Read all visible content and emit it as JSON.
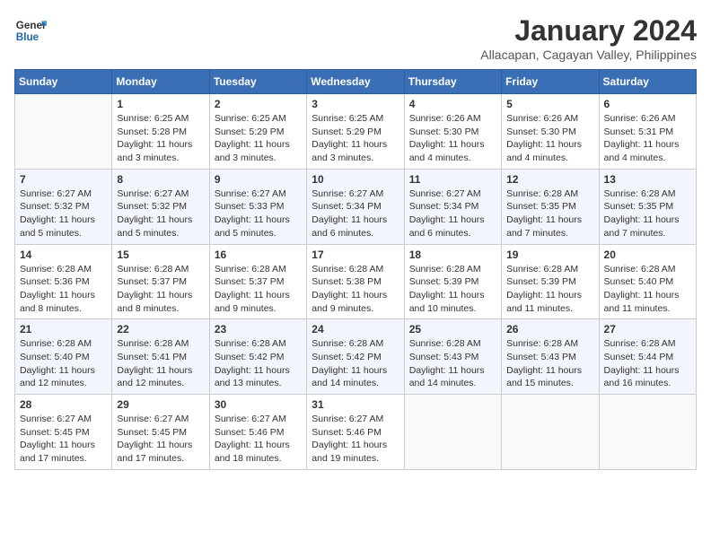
{
  "header": {
    "logo_general": "General",
    "logo_blue": "Blue",
    "month_title": "January 2024",
    "subtitle": "Allacapan, Cagayan Valley, Philippines"
  },
  "columns": [
    "Sunday",
    "Monday",
    "Tuesday",
    "Wednesday",
    "Thursday",
    "Friday",
    "Saturday"
  ],
  "weeks": [
    [
      {
        "day": "",
        "info": ""
      },
      {
        "day": "1",
        "info": "Sunrise: 6:25 AM\nSunset: 5:28 PM\nDaylight: 11 hours\nand 3 minutes."
      },
      {
        "day": "2",
        "info": "Sunrise: 6:25 AM\nSunset: 5:29 PM\nDaylight: 11 hours\nand 3 minutes."
      },
      {
        "day": "3",
        "info": "Sunrise: 6:25 AM\nSunset: 5:29 PM\nDaylight: 11 hours\nand 3 minutes."
      },
      {
        "day": "4",
        "info": "Sunrise: 6:26 AM\nSunset: 5:30 PM\nDaylight: 11 hours\nand 4 minutes."
      },
      {
        "day": "5",
        "info": "Sunrise: 6:26 AM\nSunset: 5:30 PM\nDaylight: 11 hours\nand 4 minutes."
      },
      {
        "day": "6",
        "info": "Sunrise: 6:26 AM\nSunset: 5:31 PM\nDaylight: 11 hours\nand 4 minutes."
      }
    ],
    [
      {
        "day": "7",
        "info": "Sunrise: 6:27 AM\nSunset: 5:32 PM\nDaylight: 11 hours\nand 5 minutes."
      },
      {
        "day": "8",
        "info": "Sunrise: 6:27 AM\nSunset: 5:32 PM\nDaylight: 11 hours\nand 5 minutes."
      },
      {
        "day": "9",
        "info": "Sunrise: 6:27 AM\nSunset: 5:33 PM\nDaylight: 11 hours\nand 5 minutes."
      },
      {
        "day": "10",
        "info": "Sunrise: 6:27 AM\nSunset: 5:34 PM\nDaylight: 11 hours\nand 6 minutes."
      },
      {
        "day": "11",
        "info": "Sunrise: 6:27 AM\nSunset: 5:34 PM\nDaylight: 11 hours\nand 6 minutes."
      },
      {
        "day": "12",
        "info": "Sunrise: 6:28 AM\nSunset: 5:35 PM\nDaylight: 11 hours\nand 7 minutes."
      },
      {
        "day": "13",
        "info": "Sunrise: 6:28 AM\nSunset: 5:35 PM\nDaylight: 11 hours\nand 7 minutes."
      }
    ],
    [
      {
        "day": "14",
        "info": "Sunrise: 6:28 AM\nSunset: 5:36 PM\nDaylight: 11 hours\nand 8 minutes."
      },
      {
        "day": "15",
        "info": "Sunrise: 6:28 AM\nSunset: 5:37 PM\nDaylight: 11 hours\nand 8 minutes."
      },
      {
        "day": "16",
        "info": "Sunrise: 6:28 AM\nSunset: 5:37 PM\nDaylight: 11 hours\nand 9 minutes."
      },
      {
        "day": "17",
        "info": "Sunrise: 6:28 AM\nSunset: 5:38 PM\nDaylight: 11 hours\nand 9 minutes."
      },
      {
        "day": "18",
        "info": "Sunrise: 6:28 AM\nSunset: 5:39 PM\nDaylight: 11 hours\nand 10 minutes."
      },
      {
        "day": "19",
        "info": "Sunrise: 6:28 AM\nSunset: 5:39 PM\nDaylight: 11 hours\nand 11 minutes."
      },
      {
        "day": "20",
        "info": "Sunrise: 6:28 AM\nSunset: 5:40 PM\nDaylight: 11 hours\nand 11 minutes."
      }
    ],
    [
      {
        "day": "21",
        "info": "Sunrise: 6:28 AM\nSunset: 5:40 PM\nDaylight: 11 hours\nand 12 minutes."
      },
      {
        "day": "22",
        "info": "Sunrise: 6:28 AM\nSunset: 5:41 PM\nDaylight: 11 hours\nand 12 minutes."
      },
      {
        "day": "23",
        "info": "Sunrise: 6:28 AM\nSunset: 5:42 PM\nDaylight: 11 hours\nand 13 minutes."
      },
      {
        "day": "24",
        "info": "Sunrise: 6:28 AM\nSunset: 5:42 PM\nDaylight: 11 hours\nand 14 minutes."
      },
      {
        "day": "25",
        "info": "Sunrise: 6:28 AM\nSunset: 5:43 PM\nDaylight: 11 hours\nand 14 minutes."
      },
      {
        "day": "26",
        "info": "Sunrise: 6:28 AM\nSunset: 5:43 PM\nDaylight: 11 hours\nand 15 minutes."
      },
      {
        "day": "27",
        "info": "Sunrise: 6:28 AM\nSunset: 5:44 PM\nDaylight: 11 hours\nand 16 minutes."
      }
    ],
    [
      {
        "day": "28",
        "info": "Sunrise: 6:27 AM\nSunset: 5:45 PM\nDaylight: 11 hours\nand 17 minutes."
      },
      {
        "day": "29",
        "info": "Sunrise: 6:27 AM\nSunset: 5:45 PM\nDaylight: 11 hours\nand 17 minutes."
      },
      {
        "day": "30",
        "info": "Sunrise: 6:27 AM\nSunset: 5:46 PM\nDaylight: 11 hours\nand 18 minutes."
      },
      {
        "day": "31",
        "info": "Sunrise: 6:27 AM\nSunset: 5:46 PM\nDaylight: 11 hours\nand 19 minutes."
      },
      {
        "day": "",
        "info": ""
      },
      {
        "day": "",
        "info": ""
      },
      {
        "day": "",
        "info": ""
      }
    ]
  ]
}
